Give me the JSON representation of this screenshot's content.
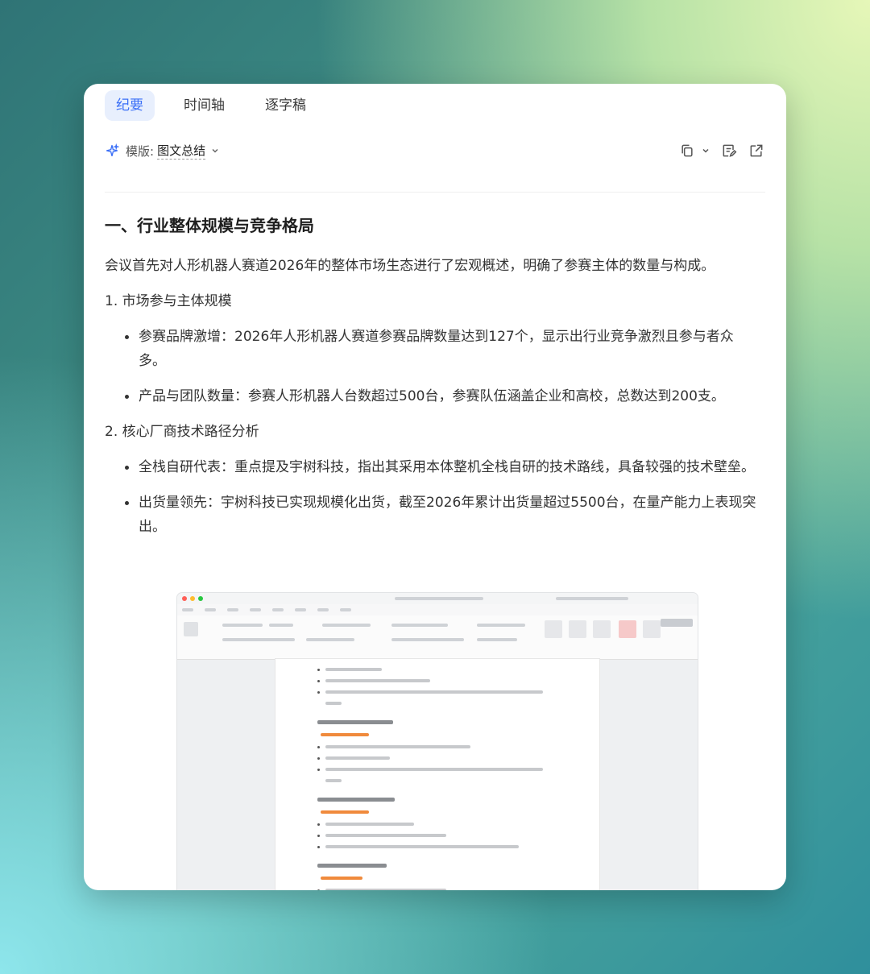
{
  "tabs": [
    {
      "label": "纪要",
      "active": true
    },
    {
      "label": "时间轴",
      "active": false
    },
    {
      "label": "逐字稿",
      "active": false
    }
  ],
  "template": {
    "label": "模版:",
    "value": "图文总结"
  },
  "icons": {
    "template": "sparkle-icon",
    "copy": "copy-icon",
    "dropdown": "chevron-down-icon",
    "edit": "edit-note-icon",
    "share": "external-link-icon"
  },
  "summary": {
    "section_title": "一、行业整体规模与竞争格局",
    "intro": "会议首先对人形机器人赛道2026年的整体市场生态进行了宏观概述，明确了参赛主体的数量与构成。",
    "sub1_title": "1. 市场参与主体规模",
    "sub1_items": [
      "参赛品牌激增：2026年人形机器人赛道参赛品牌数量达到127个，显示出行业竞争激烈且参与者众多。",
      "产品与团队数量：参赛人形机器人台数超过500台，参赛队伍涵盖企业和高校，总数达到200支。"
    ],
    "sub2_title": "2. 核心厂商技术路径分析",
    "sub2_items": [
      "全栈自研代表：重点提及宇树科技，指出其采用本体整机全栈自研的技术路线，具备较强的技术壁垒。",
      "出货量领先：宇树科技已实现规模化出货，截至2026年累计出货量超过5500台，在量产能力上表现突出。"
    ]
  },
  "colors": {
    "accent": "#3a6ff7",
    "tab_active_bg": "#e8effd",
    "orange_tag": "#f08a3c"
  }
}
